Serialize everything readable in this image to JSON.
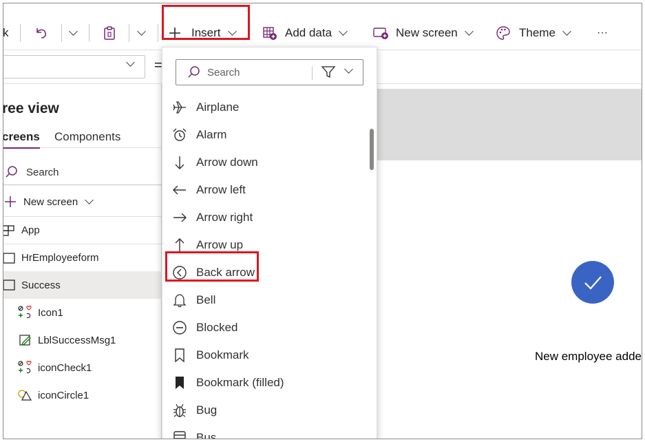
{
  "toolbar": {
    "partial_left": "k",
    "insert_label": "Insert",
    "add_data_label": "Add data",
    "new_screen_label": "New screen",
    "theme_label": "Theme",
    "more_label": "···"
  },
  "tree": {
    "title": "ree view",
    "tabs": [
      "creens",
      "Components"
    ],
    "search_placeholder": "Search",
    "new_screen_label": "New screen",
    "items": [
      {
        "label": "App",
        "icon": "app-icon",
        "indent": 0
      },
      {
        "label": "HrEmployeeform",
        "icon": "screen-icon",
        "indent": 0
      },
      {
        "label": "Success",
        "icon": "screen-icon",
        "indent": 0,
        "selected": true
      },
      {
        "label": "Icon1",
        "icon": "icon-control-icon",
        "indent": 1
      },
      {
        "label": "LblSuccessMsg1",
        "icon": "edit-label-icon",
        "indent": 1
      },
      {
        "label": "iconCheck1",
        "icon": "icon-control-icon",
        "indent": 1
      },
      {
        "label": "iconCircle1",
        "icon": "shapes-icon",
        "indent": 1
      }
    ]
  },
  "insert_menu": {
    "search_placeholder": "Search",
    "items": [
      {
        "label": "Airplane",
        "icon": "airplane-icon"
      },
      {
        "label": "Alarm",
        "icon": "alarm-icon"
      },
      {
        "label": "Arrow down",
        "icon": "arrow-down-icon"
      },
      {
        "label": "Arrow left",
        "icon": "arrow-left-icon"
      },
      {
        "label": "Arrow right",
        "icon": "arrow-right-icon"
      },
      {
        "label": "Arrow up",
        "icon": "arrow-up-icon"
      },
      {
        "label": "Back arrow",
        "icon": "back-arrow-icon"
      },
      {
        "label": "Bell",
        "icon": "bell-icon"
      },
      {
        "label": "Blocked",
        "icon": "blocked-icon"
      },
      {
        "label": "Bookmark",
        "icon": "bookmark-icon"
      },
      {
        "label": "Bookmark (filled)",
        "icon": "bookmark-filled-icon"
      },
      {
        "label": "Bug",
        "icon": "bug-icon"
      },
      {
        "label": "Bus",
        "icon": "bus-icon"
      }
    ]
  },
  "canvas": {
    "success_message": "New employee adde"
  },
  "colors": {
    "accent": "#742774",
    "highlight": "#e0141e",
    "check_circle": "#3a64c3",
    "header_gray": "#dcdcdc"
  }
}
